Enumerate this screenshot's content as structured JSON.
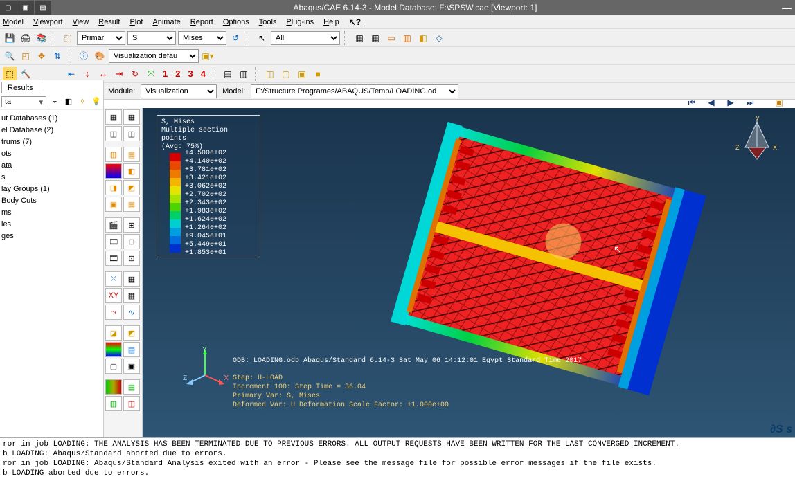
{
  "title": "Abaqus/CAE 6.14-3 - Model Database: F:\\SPSW.cae [Viewport: 1]",
  "menu": [
    "Model",
    "Viewport",
    "View",
    "Result",
    "Plot",
    "Animate",
    "Report",
    "Options",
    "Tools",
    "Plug-ins",
    "Help"
  ],
  "primary_dd": "Primary",
  "var1_dd": "S",
  "var2_dd": "Mises",
  "all_dd": "All",
  "vizdefault": "Visualization defaults",
  "module_label": "Module:",
  "module_value": "Visualization",
  "model_label": "Model:",
  "model_value": "F:/Structure Programes/ABAQUS/Temp/LOADING.odb",
  "results_tab": "Results",
  "dta_dd": "ta",
  "tree": {
    "i0": "ut Databases (1)",
    "i1": "el Database (2)",
    "i2": "trums (7)",
    "i3": "ots",
    "i4": "ata",
    "i5": "s",
    "i6": "lay Groups (1)",
    "i7": "Body Cuts",
    "i8": "ms",
    "i9": "ies",
    "i10": "ges"
  },
  "legend": {
    "title": "S, Mises",
    "sub": "Multiple section points",
    "avg": "(Avg: 75%)",
    "vals": [
      "+4.500e+02",
      "+4.140e+02",
      "+3.781e+02",
      "+3.421e+02",
      "+3.062e+02",
      "+2.702e+02",
      "+2.343e+02",
      "+1.983e+02",
      "+1.624e+02",
      "+1.264e+02",
      "+9.045e+01",
      "+5.449e+01",
      "+1.853e+01"
    ],
    "colors": [
      "#d40000",
      "#e84800",
      "#ef7a00",
      "#f4b400",
      "#e4e400",
      "#a4e400",
      "#4ed400",
      "#00d06a",
      "#00cfcf",
      "#00a0e0",
      "#006de0",
      "#0030d0"
    ]
  },
  "annot": {
    "odb": "ODB: LOADING.odb   Abaqus/Standard 6.14-3   Sat May 06 14:12:01 Egypt Standard Time 2017",
    "step": "Step: H-LOAD",
    "inc": "Increment   100: Step Time =   36.04",
    "pv": "Primary Var: S, Mises",
    "dv": "Deformed Var: U   Deformation Scale Factor: +1.000e+00"
  },
  "msgs": [
    "ror in job LOADING: THE ANALYSIS HAS BEEN TERMINATED DUE TO PREVIOUS ERRORS. ALL OUTPUT REQUESTS HAVE BEEN WRITTEN FOR THE LAST CONVERGED INCREMENT.",
    "b LOADING: Abaqus/Standard aborted due to errors.",
    "ror in job LOADING: Abaqus/Standard Analysis exited with an error - Please see the  message file for possible error messages if the file exists.",
    "b LOADING aborted due to errors."
  ],
  "nums": [
    "1",
    "2",
    "3",
    "4"
  ],
  "triad": {
    "x": "X",
    "y": "Y",
    "z": "Z"
  }
}
